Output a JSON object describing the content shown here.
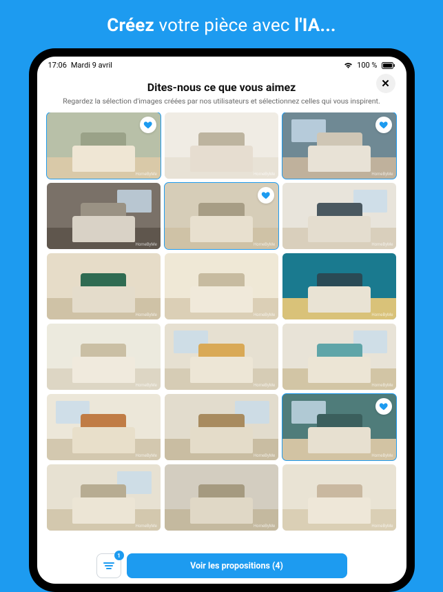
{
  "promo": {
    "prefix": "Créez",
    "mid": " votre pièce avec ",
    "suffix": "l'IA..."
  },
  "status": {
    "time": "17:06",
    "date": "Mardi 9 avril",
    "battery": "100 %"
  },
  "header": {
    "title": "Dites-nous ce que vous aimez",
    "subtitle": "Regardez la sélection d'images créées par nos utilisateurs et sélectionnez celles qui vous inspirent."
  },
  "tiles": [
    {
      "selected": true,
      "wall": "#b8c0a8",
      "floor": "#d9c9a8",
      "bed": "#efe6d4",
      "head": "#9aa288",
      "hasWindow": false
    },
    {
      "selected": false,
      "wall": "#f0ece4",
      "floor": "#e8e2d6",
      "bed": "#e6ddd0",
      "head": "#bdb49f",
      "hasWindow": false
    },
    {
      "selected": true,
      "wall": "#6f8994",
      "floor": "#bfb19c",
      "bed": "#e8e2d6",
      "head": "#cfc6b5",
      "hasWindow": true
    },
    {
      "selected": false,
      "wall": "#7a7168",
      "floor": "#5f564d",
      "bed": "#d9d2c6",
      "head": "#9a9284",
      "hasWindow": true
    },
    {
      "selected": true,
      "wall": "#d6cdb8",
      "floor": "#cfc2a6",
      "bed": "#e8e0cf",
      "head": "#a79d85",
      "hasWindow": false
    },
    {
      "selected": false,
      "wall": "#e8e4db",
      "floor": "#d9cfbc",
      "bed": "#e4ddcf",
      "head": "#4a5860",
      "hasWindow": true
    },
    {
      "selected": false,
      "wall": "#e6dcc8",
      "floor": "#cfc2a6",
      "bed": "#e4dccb",
      "head": "#2f6b52",
      "hasWindow": false
    },
    {
      "selected": false,
      "wall": "#efe8d6",
      "floor": "#dbcfb6",
      "bed": "#f0e9da",
      "head": "#c7bba0",
      "hasWindow": false
    },
    {
      "selected": false,
      "wall": "#1a7a8f",
      "floor": "#d9c279",
      "bed": "#e9e3d4",
      "head": "#2a4a55",
      "hasWindow": false
    },
    {
      "selected": false,
      "wall": "#eceade",
      "floor": "#ddd6c4",
      "bed": "#f0eadd",
      "head": "#cabfa4",
      "hasWindow": false
    },
    {
      "selected": false,
      "wall": "#e6e0d1",
      "floor": "#d6ccb5",
      "bed": "#ede6d6",
      "head": "#d9a956",
      "hasWindow": true
    },
    {
      "selected": false,
      "wall": "#e8e3d7",
      "floor": "#d2c5a5",
      "bed": "#ece5d5",
      "head": "#5fa5a8",
      "hasWindow": true
    },
    {
      "selected": false,
      "wall": "#ece7d9",
      "floor": "#d3c8af",
      "bed": "#e8dfca",
      "head": "#c07c45",
      "hasWindow": true
    },
    {
      "selected": false,
      "wall": "#e2dccd",
      "floor": "#c9bda2",
      "bed": "#e4dcc9",
      "head": "#a88b5f",
      "hasWindow": true
    },
    {
      "selected": true,
      "wall": "#4f7c7a",
      "floor": "#d2c3a3",
      "bed": "#e7e0d0",
      "head": "#3b5f5d",
      "hasWindow": true
    },
    {
      "selected": false,
      "wall": "#e7e1d2",
      "floor": "#d3c8ae",
      "bed": "#ece5d5",
      "head": "#b7ac92",
      "hasWindow": true
    },
    {
      "selected": false,
      "wall": "#d3cdc0",
      "floor": "#c4b99f",
      "bed": "#e0d8c6",
      "head": "#a59a80",
      "hasWindow": false
    },
    {
      "selected": false,
      "wall": "#e9e3d4",
      "floor": "#dacfb5",
      "bed": "#eee7d8",
      "head": "#c9b8a0",
      "hasWindow": false
    }
  ],
  "watermark": "HomeByMe",
  "bottom": {
    "filter_count": "1",
    "cta_label": "Voir les propositions (4)"
  }
}
